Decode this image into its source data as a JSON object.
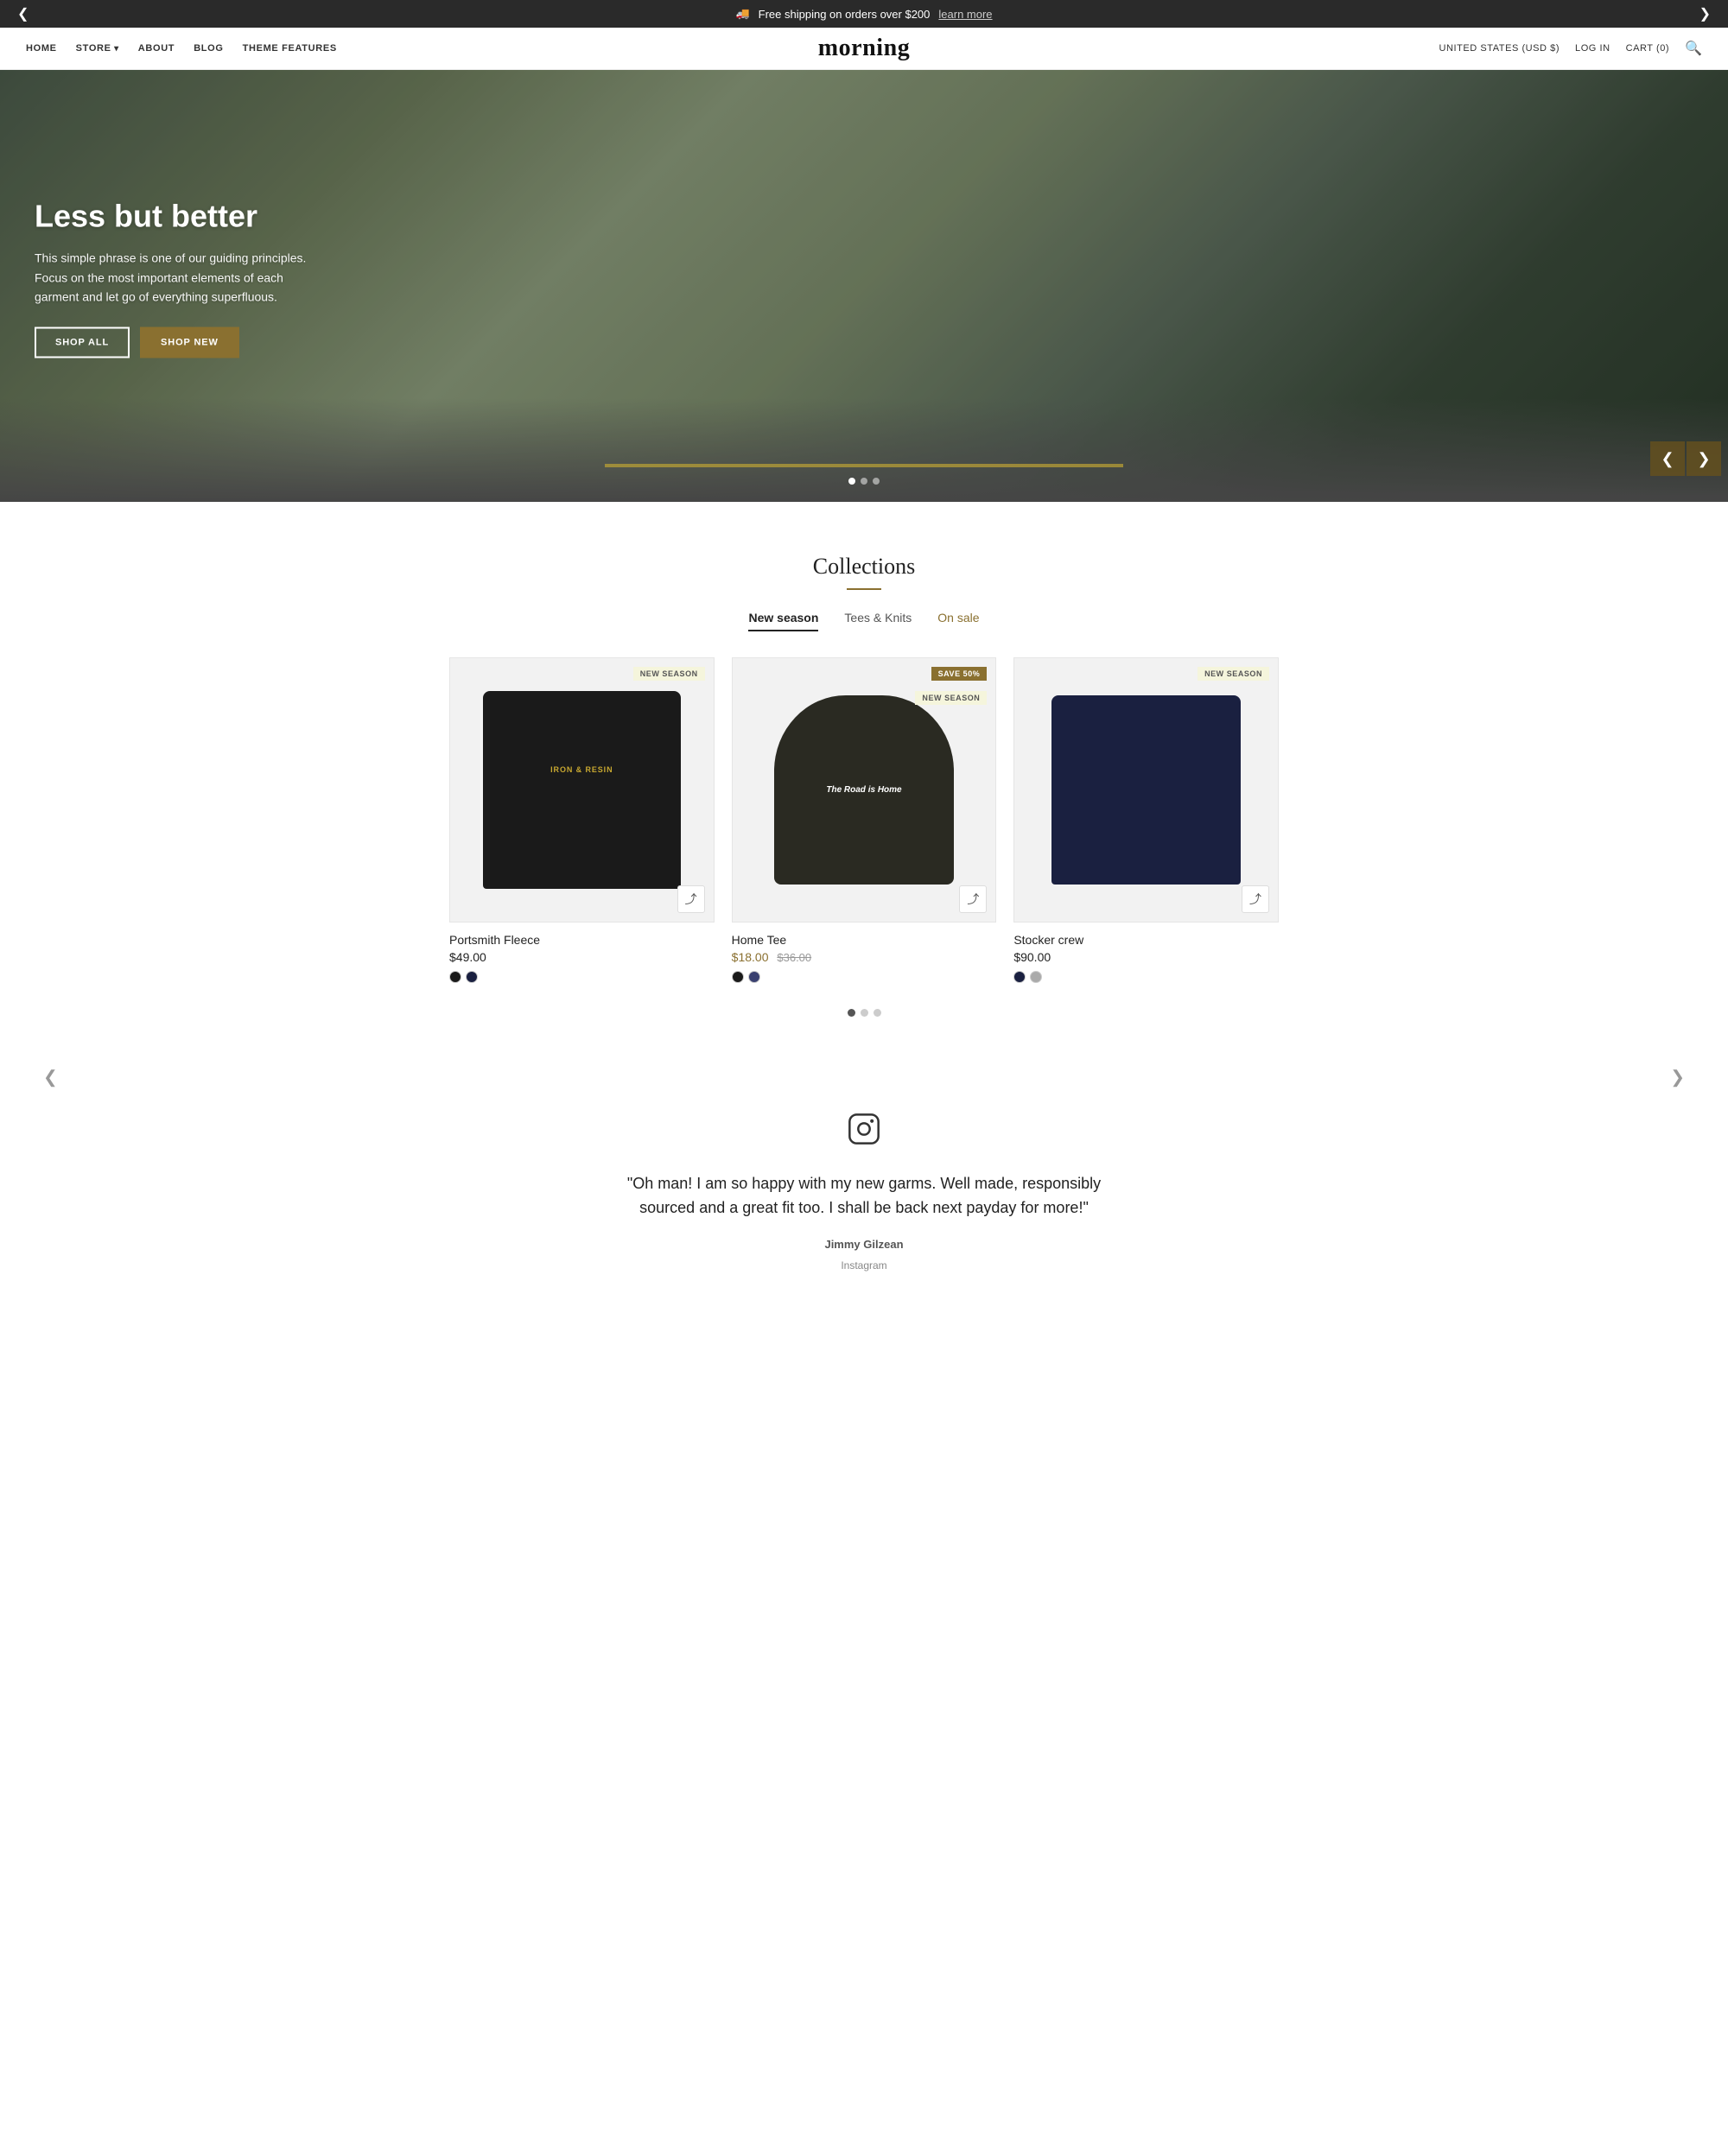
{
  "announcement": {
    "text": "Free shipping on orders over $200",
    "link_text": "learn more",
    "truck_icon": "🚚"
  },
  "nav": {
    "links": [
      {
        "label": "HOME",
        "has_dropdown": false
      },
      {
        "label": "STORE",
        "has_dropdown": true
      },
      {
        "label": "ABOUT",
        "has_dropdown": false
      },
      {
        "label": "BLOG",
        "has_dropdown": false
      },
      {
        "label": "THEME FEATURES",
        "has_dropdown": false
      }
    ],
    "logo": "morning",
    "region": "UNITED STATES (USD $)",
    "login": "LOG IN",
    "cart": "CART (0)",
    "search_icon": "🔍"
  },
  "hero": {
    "title": "Less but better",
    "description": "This simple phrase is one of our guiding principles. Focus on the most important elements of each garment and let go of everything superfluous.",
    "btn_all": "SHOP ALL",
    "btn_new": "SHOP NEW",
    "dots": [
      true,
      false,
      false
    ],
    "prev_icon": "❮",
    "next_icon": "❯"
  },
  "collections": {
    "title": "Collections",
    "tabs": [
      {
        "label": "New season",
        "active": true,
        "sale": false
      },
      {
        "label": "Tees & Knits",
        "active": false,
        "sale": false
      },
      {
        "label": "On sale",
        "active": false,
        "sale": true
      }
    ],
    "products": [
      {
        "badge": "NEW SEASON",
        "badge_type": "new",
        "name": "Portsmith Fleece",
        "price": "$49.00",
        "sale_price": null,
        "original_price": null,
        "swatches": [
          "#1a1a1a",
          "#1a2040"
        ],
        "type": "fleece"
      },
      {
        "badge": "SAVE 50%",
        "badge2": "NEW SEASON",
        "badge_type": "sale",
        "name": "Home Tee",
        "price": null,
        "sale_price": "$18.00",
        "original_price": "$36.00",
        "swatches": [
          "#1a1a1a",
          "#3a4070"
        ],
        "type": "tee"
      },
      {
        "badge": "NEW SEASON",
        "badge_type": "new",
        "name": "Stocker crew",
        "price": "$90.00",
        "sale_price": null,
        "original_price": null,
        "swatches": [
          "#1a2040",
          "#aaaaaa"
        ],
        "type": "crew"
      }
    ],
    "pagination": [
      true,
      false,
      false
    ]
  },
  "testimonial": {
    "instagram_icon": "📷",
    "text": "\"Oh man! I am so happy with my new garms. Well made, responsibly sourced and a great fit too. I shall be back next payday for more!\"",
    "author": "Jimmy Gilzean",
    "sub_label": "Instagram",
    "prev_icon": "❮",
    "next_icon": "❯"
  },
  "colors": {
    "accent": "#8a7030",
    "dark": "#1a1a1a",
    "light_bg": "#f5f5f5"
  }
}
